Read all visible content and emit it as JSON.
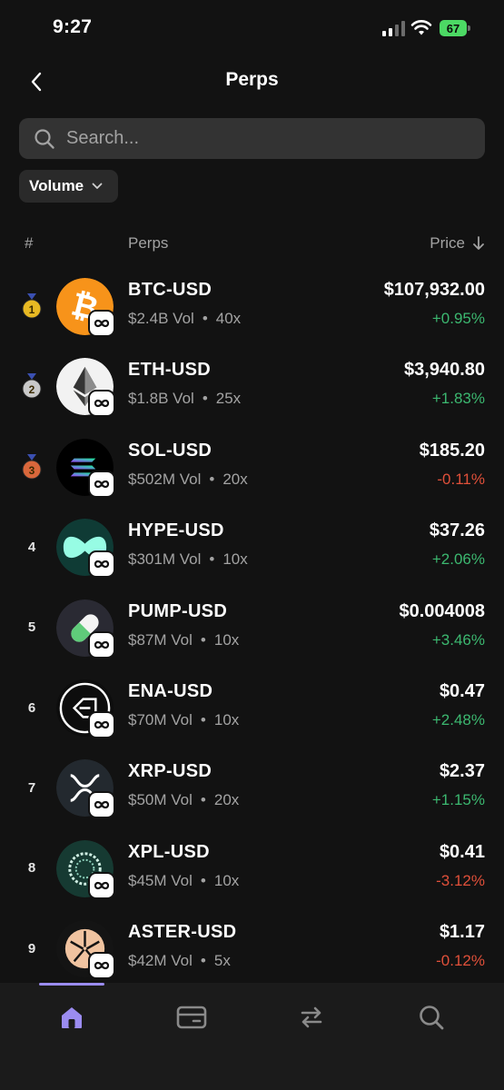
{
  "status": {
    "time": "9:27",
    "battery": "67"
  },
  "header": {
    "title": "Perps"
  },
  "search": {
    "placeholder": "Search..."
  },
  "filter": {
    "label": "Volume"
  },
  "columns": {
    "rank": "#",
    "perps": "Perps",
    "price": "Price"
  },
  "rows": [
    {
      "rank": "1",
      "medal": "gold",
      "symbol": "BTC-USD",
      "volume": "$2.4B",
      "vol_label": "Vol",
      "leverage": "40x",
      "price": "$107,932.00",
      "change": "+0.95%",
      "direction": "up",
      "icon": "bitcoin-icon"
    },
    {
      "rank": "2",
      "medal": "silver",
      "symbol": "ETH-USD",
      "volume": "$1.8B",
      "vol_label": "Vol",
      "leverage": "25x",
      "price": "$3,940.80",
      "change": "+1.83%",
      "direction": "up",
      "icon": "ethereum-icon"
    },
    {
      "rank": "3",
      "medal": "bronze",
      "symbol": "SOL-USD",
      "volume": "$502M",
      "vol_label": "Vol",
      "leverage": "20x",
      "price": "$185.20",
      "change": "-0.11%",
      "direction": "down",
      "icon": "solana-icon"
    },
    {
      "rank": "4",
      "medal": "",
      "symbol": "HYPE-USD",
      "volume": "$301M",
      "vol_label": "Vol",
      "leverage": "10x",
      "price": "$37.26",
      "change": "+2.06%",
      "direction": "up",
      "icon": "hyperliquid-icon"
    },
    {
      "rank": "5",
      "medal": "",
      "symbol": "PUMP-USD",
      "volume": "$87M",
      "vol_label": "Vol",
      "leverage": "10x",
      "price": "$0.004008",
      "change": "+3.46%",
      "direction": "up",
      "icon": "pill-icon"
    },
    {
      "rank": "6",
      "medal": "",
      "symbol": "ENA-USD",
      "volume": "$70M",
      "vol_label": "Vol",
      "leverage": "10x",
      "price": "$0.47",
      "change": "+2.48%",
      "direction": "up",
      "icon": "ethena-icon"
    },
    {
      "rank": "7",
      "medal": "",
      "symbol": "XRP-USD",
      "volume": "$50M",
      "vol_label": "Vol",
      "leverage": "20x",
      "price": "$2.37",
      "change": "+1.15%",
      "direction": "up",
      "icon": "xrp-icon"
    },
    {
      "rank": "8",
      "medal": "",
      "symbol": "XPL-USD",
      "volume": "$45M",
      "vol_label": "Vol",
      "leverage": "10x",
      "price": "$0.41",
      "change": "-3.12%",
      "direction": "down",
      "icon": "plasma-icon"
    },
    {
      "rank": "9",
      "medal": "",
      "symbol": "ASTER-USD",
      "volume": "$42M",
      "vol_label": "Vol",
      "leverage": "5x",
      "price": "$1.17",
      "change": "-0.12%",
      "direction": "down",
      "icon": "aster-icon"
    }
  ],
  "nav": {
    "items": [
      "home-icon",
      "wallet-icon",
      "swap-icon",
      "search-icon"
    ],
    "active": "home-icon"
  },
  "colors": {
    "background": "#121212",
    "positive": "#3cb870",
    "negative": "#e0503a",
    "accent": "#9b8cf0"
  }
}
